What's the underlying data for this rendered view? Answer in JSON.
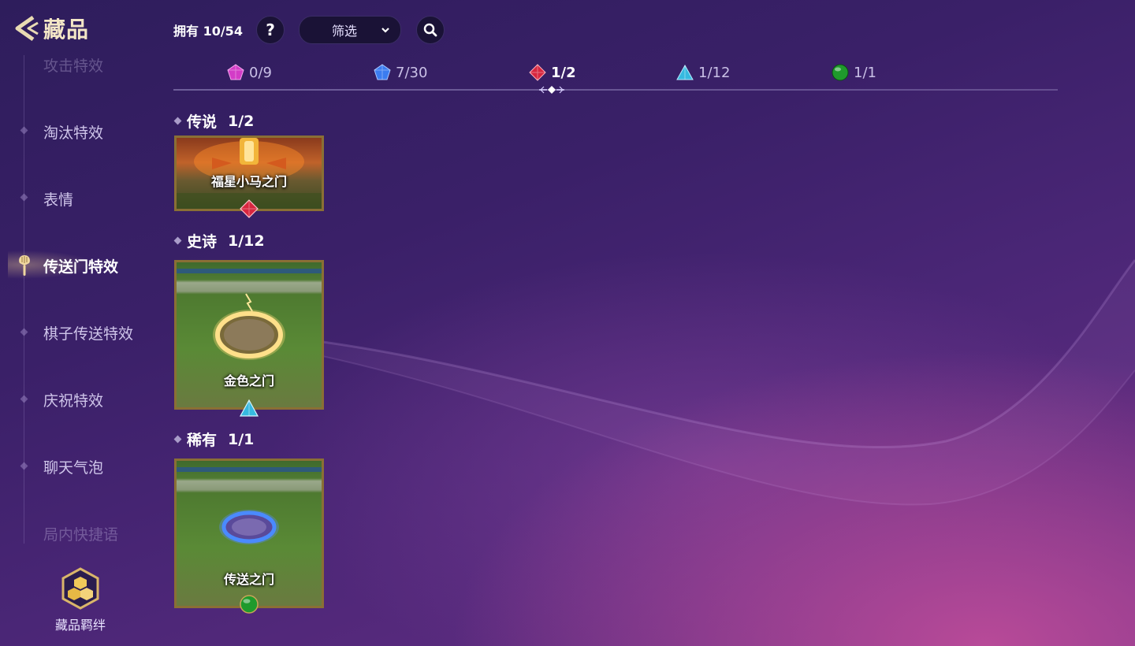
{
  "header": {
    "title": "藏品",
    "owned_label": "拥有 10/54",
    "help_label": "?",
    "filter_label": "筛选"
  },
  "tabs": [
    {
      "count": "0/9",
      "icon": "purple-gem-icon",
      "color": "#d33cc7"
    },
    {
      "count": "7/30",
      "icon": "blue-gem-icon",
      "color": "#3b7cf0"
    },
    {
      "count": "1/2",
      "icon": "red-gem-icon",
      "color": "#d8263f",
      "active": true
    },
    {
      "count": "1/12",
      "icon": "cyan-triangle-icon",
      "color": "#36b9e0"
    },
    {
      "count": "1/1",
      "icon": "green-orb-icon",
      "color": "#1f9a2c"
    }
  ],
  "sidebar": {
    "items": [
      {
        "label": "攻击特效"
      },
      {
        "label": "淘汰特效"
      },
      {
        "label": "表情"
      },
      {
        "label": "传送门特效",
        "active": true
      },
      {
        "label": "棋子传送特效"
      },
      {
        "label": "庆祝特效"
      },
      {
        "label": "聊天气泡"
      },
      {
        "label": "局内快捷语"
      }
    ],
    "bond_label": "藏品羁绊"
  },
  "sections": [
    {
      "title": "传说",
      "count": "1/2",
      "item": "福星小马之门"
    },
    {
      "title": "史诗",
      "count": "1/12",
      "item": "金色之门"
    },
    {
      "title": "稀有",
      "count": "1/1",
      "item": "传送之门"
    }
  ]
}
